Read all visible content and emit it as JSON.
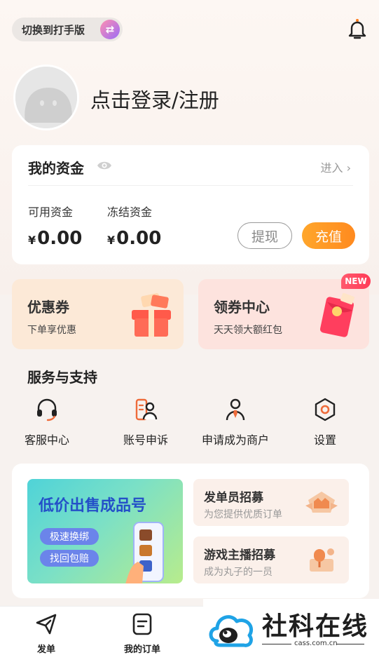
{
  "header": {
    "switch_label": "切换到打手版",
    "switch_icon": "swap-icon",
    "bell_icon": "bell-icon"
  },
  "profile": {
    "login_text": "点击登录/注册"
  },
  "funds": {
    "title": "我的资金",
    "enter": "进入 ›",
    "available_label": "可用资金",
    "available_currency": "¥",
    "available_value": "0.00",
    "frozen_label": "冻结资金",
    "frozen_currency": "¥",
    "frozen_value": "0.00",
    "withdraw_label": "提现",
    "recharge_label": "充值"
  },
  "promos": {
    "coupon_title": "优惠券",
    "coupon_sub": "下单享优惠",
    "center_title": "领券中心",
    "center_sub": "天天领大额红包",
    "new_badge": "NEW"
  },
  "services": {
    "title": "服务与支持",
    "items": [
      {
        "label": "客服中心",
        "icon": "headset-icon"
      },
      {
        "label": "账号申诉",
        "icon": "account-appeal-icon"
      },
      {
        "label": "申请成为商户",
        "icon": "merchant-icon"
      },
      {
        "label": "设置",
        "icon": "settings-icon"
      }
    ]
  },
  "banner": {
    "headline": "低价出售成品号",
    "tag1": "极速换绑",
    "tag2": "找回包赔",
    "recruit1_title": "发单员招募",
    "recruit1_sub": "为您提供优质订单",
    "recruit2_title": "游戏主播招募",
    "recruit2_sub": "成为丸子的一员"
  },
  "tabbar": {
    "tab1": "发单",
    "tab2": "我的订单"
  },
  "watermark": {
    "text": "社科在线",
    "url": "cass.com.cn"
  },
  "colors": {
    "accent_orange": "#ff8a1f",
    "background": "#f7f2ef",
    "service_icon": "#ee6b3a",
    "banner_blue": "#2450c8"
  }
}
